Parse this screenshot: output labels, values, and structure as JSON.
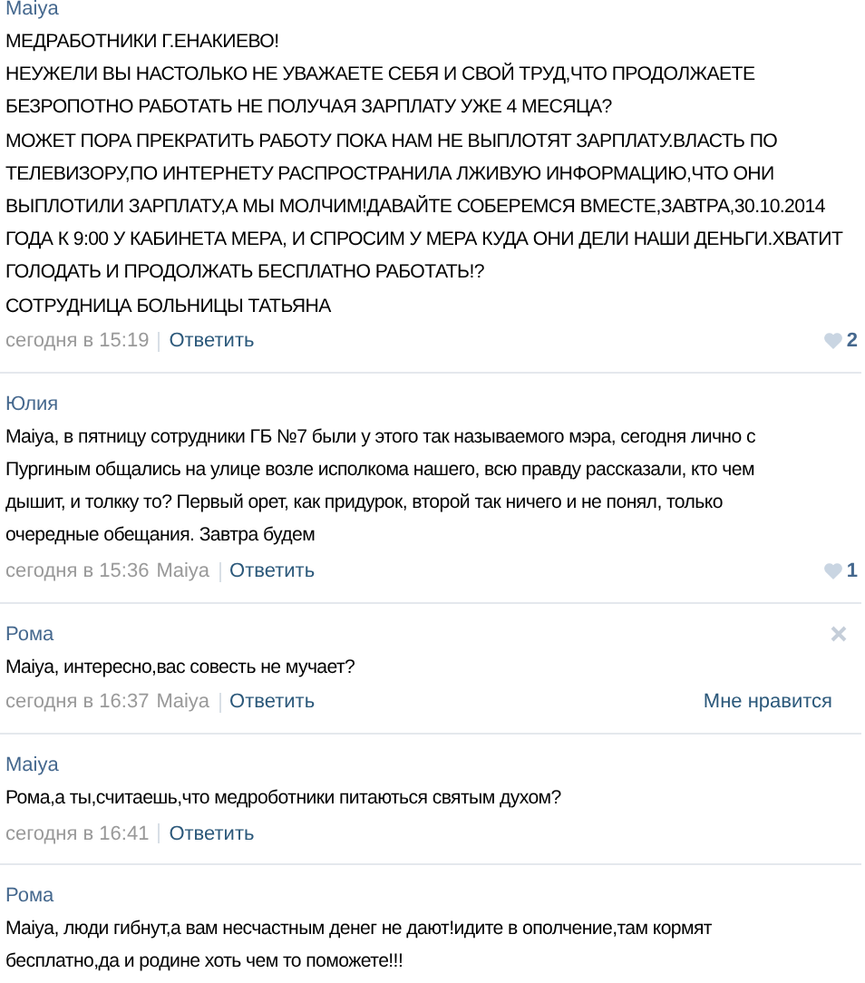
{
  "comments": [
    {
      "author": "Maiya",
      "lines": [
        "МЕДРАБОТНИКИ Г.ЕНАКИЕВО!",
        "НЕУЖЕЛИ ВЫ НАСТОЛЬКО НЕ УВАЖАЕТЕ СЕБЯ И СВОЙ ТРУД,ЧТО ПРОДОЛЖАЕТЕ",
        "БЕЗРОПОТНО РАБОТАТЬ НЕ ПОЛУЧАЯ ЗАРПЛАТУ УЖЕ 4 МЕСЯЦА?",
        "МОЖЕТ ПОРА ПРЕКРАТИТЬ РАБОТУ ПОКА НАМ НЕ ВЫПЛОТЯТ ЗАРПЛАТУ.ВЛАСТЬ ПО",
        "ТЕЛЕВИЗОРУ,ПО ИНТЕРНЕТУ РАСПРОСТРАНИЛА ЛЖИВУЮ ИНФОРМАЦИЮ,ЧТО ОНИ",
        "ВЫПЛОТИЛИ ЗАРПЛАТУ,А МЫ МОЛЧИМ!ДАВАЙТЕ СОБЕРЕМСЯ ВМЕСТЕ,ЗАВТРА,30.10.2014",
        "ГОДА К 9:00 У КАБИНЕТА МЕРА, И СПРОСИМ У МЕРА КУДА ОНИ ДЕЛИ НАШИ ДЕНЬГИ.ХВАТИТ",
        "ГОЛОДАТЬ И ПРОДОЛЖАТЬ БЕСПЛАТНО РАБОТАТЬ!?",
        "СОТРУДНИЦА БОЛЬНИЦЫ ТАТЬЯНА"
      ],
      "time": "сегодня в 15:19",
      "reply": "Ответить",
      "like": {
        "kind": "count",
        "text": "2"
      },
      "deletable": false
    },
    {
      "author": "Юлия",
      "lines": [
        "Maiya, в пятницу сотрудники ГБ №7 были у этого так называемого мэра, сегодня лично с",
        "Пургиным общались на улице возле исполкома нашего, всю правду рассказали, кто чем",
        "дышит, и толкку то? Первый орет, как придурок, второй так ничего и не понял, только",
        "очередные обещания. Завтра будем"
      ],
      "time": "сегодня в 15:36",
      "reply_to": "Maiya",
      "reply": "Ответить",
      "like": {
        "kind": "count",
        "text": "1"
      },
      "deletable": false
    },
    {
      "author": "Рома",
      "lines": [
        "Maiya, интересно,вас совесть не мучает?"
      ],
      "time": "сегодня в 16:37",
      "reply_to": "Maiya",
      "reply": "Ответить",
      "like": {
        "kind": "link",
        "text": "Мне нравится"
      },
      "deletable": true
    },
    {
      "author": "Maiya",
      "lines": [
        "Рома,а ты,считаешь,что медроботники питаються святым духом?"
      ],
      "time": "сегодня в 16:41",
      "reply": "Ответить",
      "deletable": false
    },
    {
      "author": "Рома",
      "lines": [
        "Maiya, люди гибнут,а вам несчастным денег не дают!идите в ополчение,там кормят",
        "бесплатно,да и родине хоть чем то поможете!!!"
      ],
      "deletable": false
    }
  ]
}
